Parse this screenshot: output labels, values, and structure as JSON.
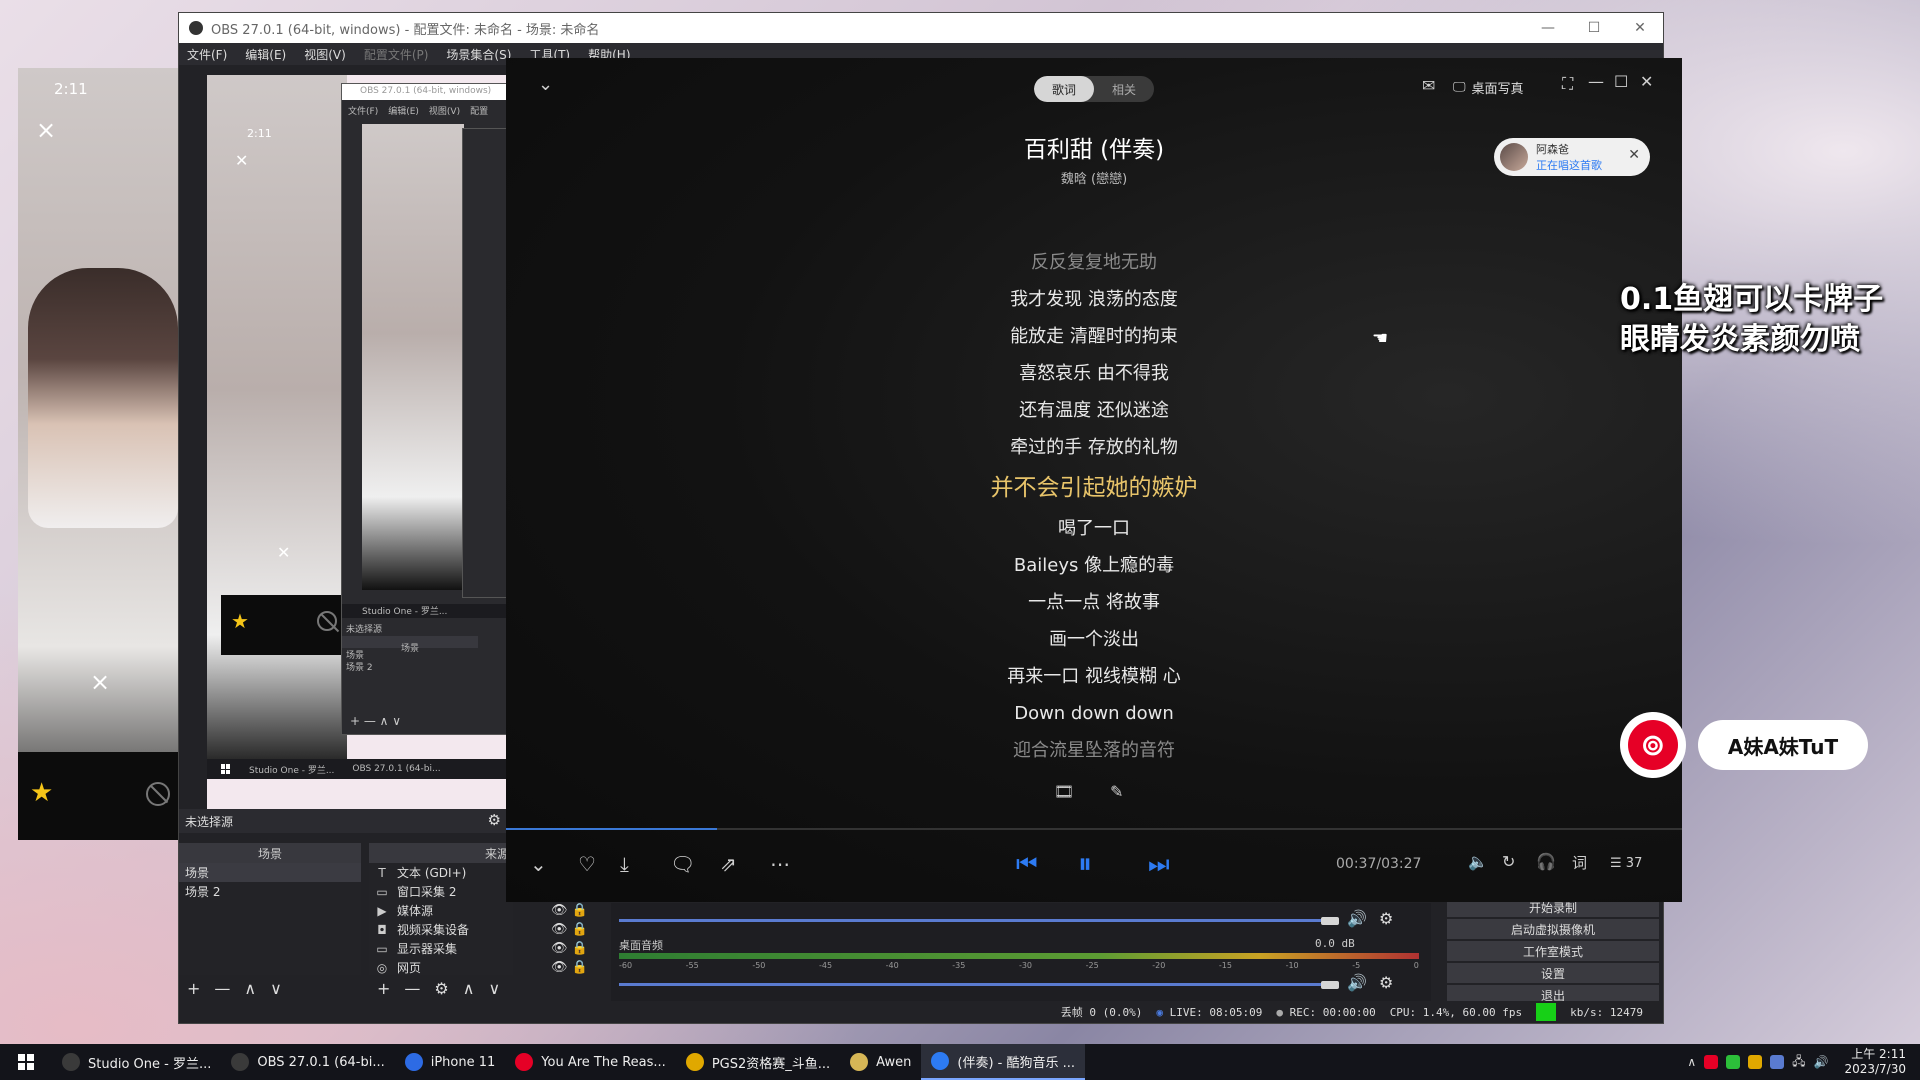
{
  "desktop_preview": {
    "time": "2:11",
    "close": "×"
  },
  "obs": {
    "title": "OBS 27.0.1 (64-bit, windows) - 配置文件: 未命名 - 场景: 未命名",
    "menu": [
      "文件(F)",
      "编辑(E)",
      "视图(V)",
      "配置文件(P)",
      "场景集合(S)",
      "工具(T)",
      "帮助(H)"
    ],
    "nested_title": "OBS 27.0.1 (64-bit, windows)",
    "nested_menu": [
      "文件(F)",
      "编辑(E)",
      "视图(V)",
      "配置"
    ],
    "nested_taskbar": [
      "Studio One - 罗兰...",
      "OBS 27.0.1 (64-bi..."
    ],
    "nested_no_source": "未选择源",
    "nested_scene_header": "场景",
    "nested_scenes": [
      "场景",
      "场景 2"
    ],
    "no_source_selected": "未选择源",
    "scenes_header": "场景",
    "sources_header": "来源",
    "scenes": [
      "场景",
      "场景 2"
    ],
    "sources": [
      {
        "icon": "T",
        "label": "文本 (GDI+)"
      },
      {
        "icon": "▭",
        "label": "窗口采集 2"
      },
      {
        "icon": "▶",
        "label": "媒体源"
      },
      {
        "icon": "◘",
        "label": "视频采集设备"
      },
      {
        "icon": "▭",
        "label": "显示器采集"
      },
      {
        "icon": "◎",
        "label": "网页"
      }
    ],
    "mixer_label": "桌面音频",
    "mixer_db": "0.0 dB",
    "meter_ticks": [
      "-60",
      "-55",
      "-50",
      "-45",
      "-40",
      "-35",
      "-30",
      "-25",
      "-20",
      "-15",
      "-10",
      "-5",
      "0"
    ],
    "controls": [
      "开始录制",
      "启动虚拟摄像机",
      "工作室模式",
      "设置",
      "退出"
    ],
    "status": {
      "dropped": "丢帧 0 (0.0%)",
      "live": "LIVE: 08:05:09",
      "rec": "REC: 00:00:00",
      "cpu": "CPU: 1.4%, 60.00 fps",
      "kbs": "kb/s: 12479"
    }
  },
  "player": {
    "tabs": [
      "歌词",
      "相关"
    ],
    "desk_lyrics": "桌面写真",
    "song_title": "百利甜 (伴奏)",
    "artist": "魏晗 (戀戀)",
    "listener": {
      "name": "阿森爸",
      "status": "正在唱这首歌"
    },
    "lyrics": [
      {
        "text": "反反复复地无助",
        "state": "dim"
      },
      {
        "text": "我才发现 浪荡的态度",
        "state": "normal"
      },
      {
        "text": "能放走 清醒时的拘束",
        "state": "normal"
      },
      {
        "text": "喜怒哀乐 由不得我",
        "state": "normal"
      },
      {
        "text": "还有温度 还似迷途",
        "state": "normal"
      },
      {
        "text": "牵过的手 存放的礼物",
        "state": "normal"
      },
      {
        "text": "并不会引起她的嫉妒",
        "state": "cur"
      },
      {
        "text": "喝了一口",
        "state": "normal"
      },
      {
        "text": "Baileys 像上瘾的毒",
        "state": "normal"
      },
      {
        "text": "一点一点 将故事",
        "state": "normal"
      },
      {
        "text": "画一个淡出",
        "state": "normal"
      },
      {
        "text": "再来一口 视线模糊 心",
        "state": "normal"
      },
      {
        "text": "Down down down",
        "state": "normal"
      },
      {
        "text": "迎合流星坠落的音符",
        "state": "dim"
      }
    ],
    "time": "00:37/03:27",
    "progress": 0.179,
    "lyric_btn": "词",
    "playlist_count": "37"
  },
  "overlay": {
    "line1": "0.1鱼翅可以卡牌子",
    "line2": "眼睛发炎素颜勿喷",
    "nickname": "A妹A妹TuT"
  },
  "taskbar": {
    "items": [
      {
        "label": "Studio One - 罗兰...",
        "color": "#3a3a3a"
      },
      {
        "label": "OBS 27.0.1 (64-bi...",
        "color": "#3a3a3a"
      },
      {
        "label": "iPhone 11",
        "color": "#2d6be4"
      },
      {
        "label": "You Are The Reas...",
        "color": "#e60026"
      },
      {
        "label": "PGS2资格赛_斗鱼...",
        "color": "#e0a800"
      },
      {
        "label": "Awen",
        "color": "#d6b656"
      },
      {
        "label": "(伴奏) - 酷狗音乐 ...",
        "color": "#2d7bf3"
      }
    ],
    "clock_time": "上午 2:11",
    "clock_date": "2023/7/30"
  },
  "colors": {
    "accent_blue": "#2d7bf3",
    "lyric_current": "#e8c46a",
    "netease_red": "#e60026"
  }
}
